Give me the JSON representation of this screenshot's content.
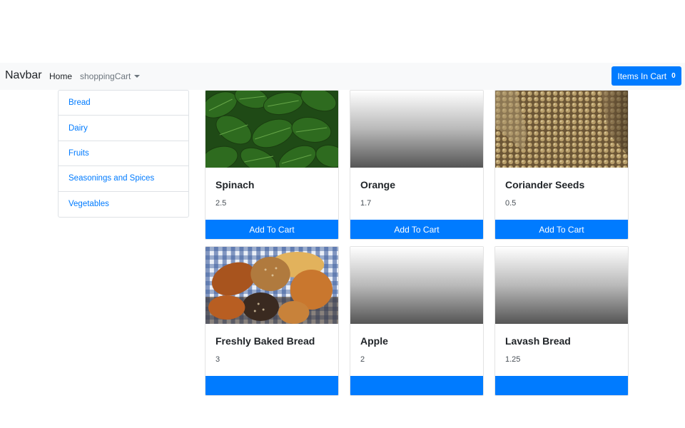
{
  "navbar": {
    "brand": "Navbar",
    "home": "Home",
    "dropdown": "shoppingCart",
    "cart_label": "Items In Cart",
    "cart_count": "0",
    "accent_color": "#007bff",
    "background_color": "#f8f9fa"
  },
  "sidebar": {
    "items": [
      {
        "label": "Bread"
      },
      {
        "label": "Dairy"
      },
      {
        "label": "Fruits"
      },
      {
        "label": "Seasonings and Spices"
      },
      {
        "label": "Vegetables"
      }
    ]
  },
  "products": [
    {
      "name": "Spinach",
      "price": "2.5",
      "button": "Add To Cart",
      "image": "spinach-leaves"
    },
    {
      "name": "Orange",
      "price": "1.7",
      "button": "Add To Cart",
      "image": "placeholder-gradient"
    },
    {
      "name": "Coriander Seeds",
      "price": "0.5",
      "button": "Add To Cart",
      "image": "coriander-seeds"
    },
    {
      "name": "Freshly Baked Bread",
      "price": "3",
      "button": "",
      "image": "bread-basket"
    },
    {
      "name": "Apple",
      "price": "2",
      "button": "",
      "image": "placeholder-gradient"
    },
    {
      "name": "Lavash Bread",
      "price": "1.25",
      "button": "",
      "image": "placeholder-gradient"
    }
  ]
}
